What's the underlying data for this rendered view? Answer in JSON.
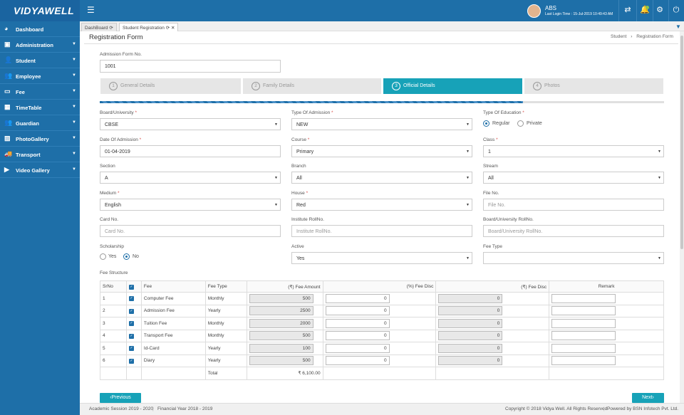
{
  "app": {
    "logo": "VIDYAWELL"
  },
  "user": {
    "name": "ABS",
    "last_login": "Last Login Time : 15-Jul-2019 10:49:43 AM"
  },
  "sidebar": {
    "items": [
      {
        "label": "Dashboard",
        "icon": "dashboard-icon"
      },
      {
        "label": "Administration",
        "icon": "administration-icon"
      },
      {
        "label": "Student",
        "icon": "student-icon"
      },
      {
        "label": "Employee",
        "icon": "employee-icon"
      },
      {
        "label": "Fee",
        "icon": "fee-icon"
      },
      {
        "label": "TimeTable",
        "icon": "timetable-icon"
      },
      {
        "label": "Guardian",
        "icon": "guardian-icon"
      },
      {
        "label": "PhotoGallery",
        "icon": "photo-gallery-icon"
      },
      {
        "label": "Transport",
        "icon": "transport-icon"
      },
      {
        "label": "Video Gallery",
        "icon": "video-gallery-icon"
      }
    ]
  },
  "tabs": [
    {
      "label": "DashBoard"
    },
    {
      "label": "Student Registration"
    }
  ],
  "page": {
    "title": "Registration Form",
    "breadcrumb_parent": "Student",
    "breadcrumb_sep": "›",
    "breadcrumb_current": "Registration Form"
  },
  "form": {
    "admission_no_label": "Admission Form No.",
    "admission_no": "1001",
    "steps": [
      {
        "num": "1",
        "label": "General Details"
      },
      {
        "num": "2",
        "label": "Family Details"
      },
      {
        "num": "3",
        "label": "Official Details"
      },
      {
        "num": "4",
        "label": "Photos"
      }
    ],
    "progress_fraction": 0.75,
    "board_label": "Board/University",
    "board": "CBSE",
    "admission_type_label": "Type Of Admission",
    "admission_type": "NEW",
    "education_type_label": "Type Of Education",
    "education_regular": "Regular",
    "education_private": "Private",
    "doa_label": "Date Of Admission",
    "doa": "01-04-2019",
    "course_label": "Course",
    "course": "Primary",
    "class_label": "Class",
    "class": "1",
    "section_label": "Section",
    "section": "A",
    "branch_label": "Branch",
    "branch": "All",
    "stream_label": "Stream",
    "stream": "All",
    "medium_label": "Medium",
    "medium": "English",
    "house_label": "House",
    "house": "Red",
    "fileno_label": "File No.",
    "fileno_placeholder": "File No.",
    "cardno_label": "Card No.",
    "cardno_placeholder": "Card No.",
    "inst_roll_label": "Institute RollNo.",
    "inst_roll_placeholder": "Institute RollNo.",
    "board_roll_label": "Board/University RollNo.",
    "board_roll_placeholder": "Board/University RollNo.",
    "scholarship_label": "Scholarship",
    "scholarship_yes": "Yes",
    "scholarship_no": "No",
    "active_label": "Active",
    "active": "Yes",
    "fee_type_label": "Fee Type",
    "fee_type": "",
    "fee_structure_label": "Fee Structure",
    "required_mark": "*"
  },
  "fee_table": {
    "headers": {
      "srno": "SrNo",
      "fee": "Fee",
      "fee_type": "Fee Type",
      "amount": "(₹) Fee Amount",
      "pct_disc": "(%) Fee Disc",
      "rs_disc": "(₹) Fee Disc",
      "remark": "Remark"
    },
    "rows": [
      {
        "srno": "1",
        "fee": "Computer Fee",
        "type": "Monthly",
        "amount": "500",
        "pct": "0",
        "rs": "0"
      },
      {
        "srno": "2",
        "fee": "Admission Fee",
        "type": "Yearly",
        "amount": "2500",
        "pct": "0",
        "rs": "0"
      },
      {
        "srno": "3",
        "fee": "Tuition Fee",
        "type": "Monthly",
        "amount": "2000",
        "pct": "0",
        "rs": "0"
      },
      {
        "srno": "4",
        "fee": "Transport Fee",
        "type": "Monthly",
        "amount": "500",
        "pct": "0",
        "rs": "0"
      },
      {
        "srno": "5",
        "fee": "Id-Card",
        "type": "Yearly",
        "amount": "100",
        "pct": "0",
        "rs": "0"
      },
      {
        "srno": "6",
        "fee": "Diary",
        "type": "Yearly",
        "amount": "500",
        "pct": "0",
        "rs": "0"
      }
    ],
    "total_label": "Total",
    "total": "₹ 6,100.00"
  },
  "buttons": {
    "prev": "‹Previous",
    "next": "Next›"
  },
  "footer": {
    "session": "Academic Session 2019 - 2020",
    "fy": "Financial Year 2018 - 2019",
    "copyright": "Copyright © 2018 Vidya Well. All Rights Reserved",
    "powered": "Powered by BSN Infotech Pvt. Ltd."
  }
}
